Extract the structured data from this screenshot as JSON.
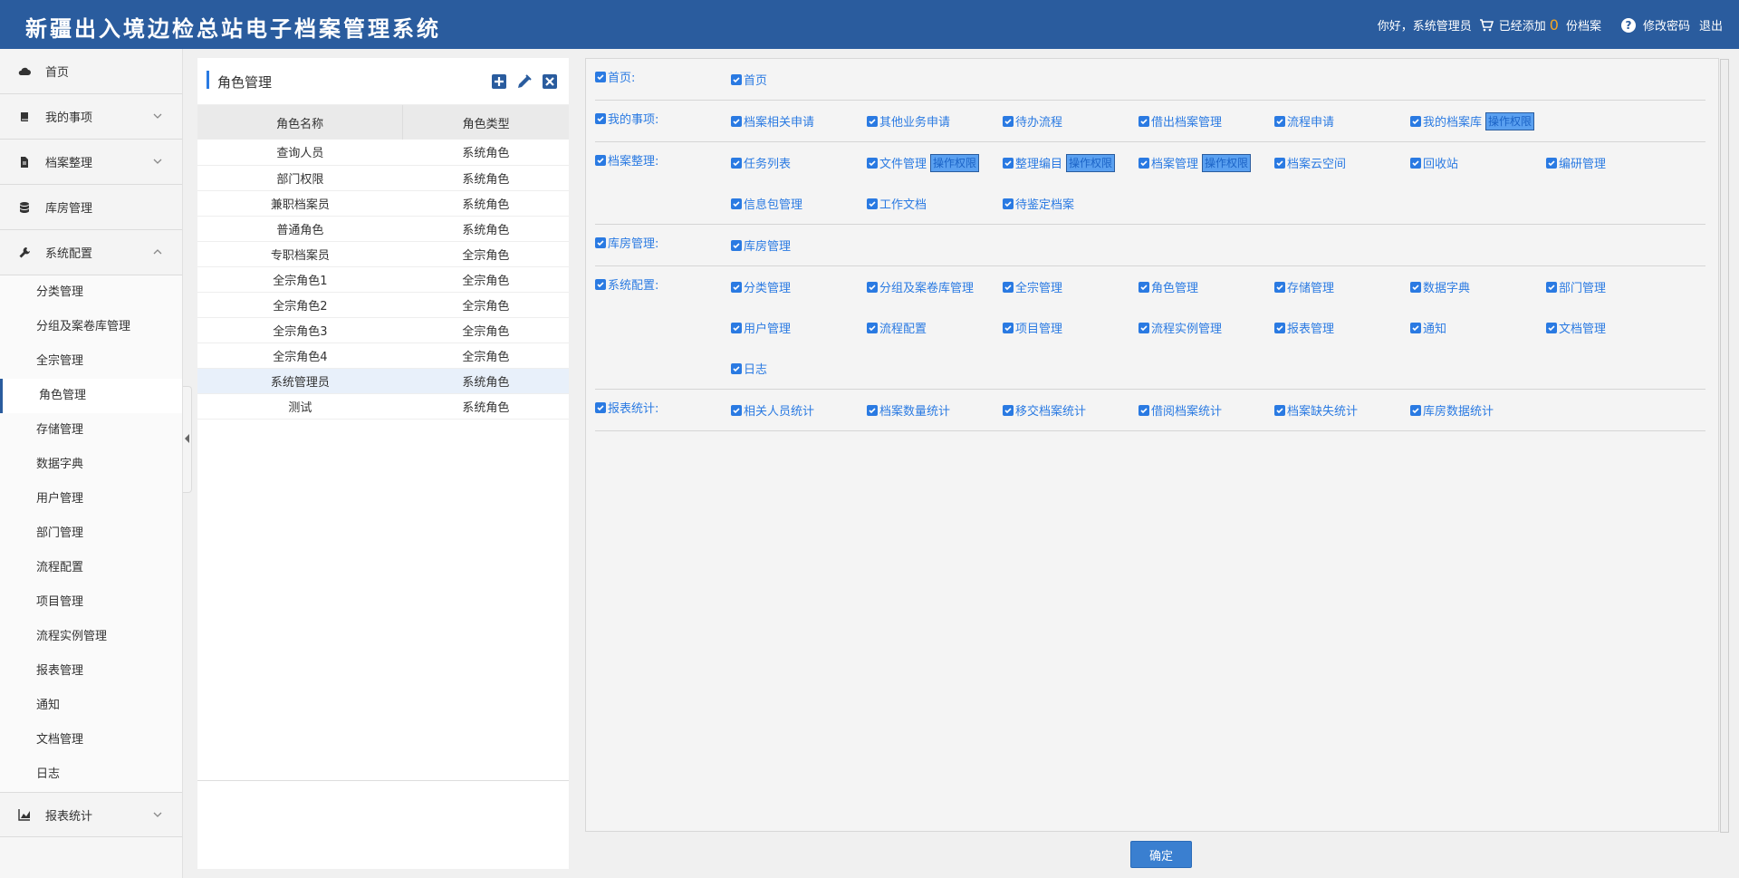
{
  "header": {
    "title": "新疆出入境边检总站电子档案管理系统",
    "greeting": "你好，系统管理员",
    "cart_prefix": "已经添加",
    "cart_count": "0",
    "cart_suffix": "份档案",
    "change_password": "修改密码",
    "logout": "退出"
  },
  "sidebar": {
    "groups": [
      {
        "label": "首页",
        "icon": "cloud-icon"
      },
      {
        "label": "我的事项",
        "icon": "book-icon"
      },
      {
        "label": "档案整理",
        "icon": "file-icon"
      },
      {
        "label": "库房管理",
        "icon": "database-icon"
      },
      {
        "label": "系统配置",
        "icon": "wrench-icon"
      }
    ],
    "sub_items": [
      "分类管理",
      "分组及案卷库管理",
      "全宗管理",
      "角色管理",
      "存储管理",
      "数据字典",
      "用户管理",
      "部门管理",
      "流程配置",
      "项目管理",
      "流程实例管理",
      "报表管理",
      "通知",
      "文档管理",
      "日志"
    ],
    "bottom_group": {
      "label": "报表统计",
      "icon": "chart-icon"
    }
  },
  "role_panel": {
    "title": "角色管理",
    "col_name": "角色名称",
    "col_type": "角色类型",
    "rows": [
      {
        "name": "查询人员",
        "type": "系统角色"
      },
      {
        "name": "部门权限",
        "type": "系统角色"
      },
      {
        "name": "兼职档案员",
        "type": "系统角色"
      },
      {
        "name": "普通角色",
        "type": "系统角色"
      },
      {
        "name": "专职档案员",
        "type": "全宗角色"
      },
      {
        "name": "全宗角色1",
        "type": "全宗角色"
      },
      {
        "name": "全宗角色2",
        "type": "全宗角色"
      },
      {
        "name": "全宗角色3",
        "type": "全宗角色"
      },
      {
        "name": "全宗角色4",
        "type": "全宗角色"
      },
      {
        "name": "系统管理员",
        "type": "系统角色"
      },
      {
        "name": "测试",
        "type": "系统角色"
      }
    ]
  },
  "permissions": {
    "op_label": "操作权限",
    "sections": [
      {
        "category": "首页:",
        "items": [
          {
            "label": "首页"
          }
        ]
      },
      {
        "category": "我的事项:",
        "items": [
          {
            "label": "档案相关申请"
          },
          {
            "label": "其他业务申请"
          },
          {
            "label": "待办流程"
          },
          {
            "label": "借出档案管理"
          },
          {
            "label": "流程申请"
          },
          {
            "label": "我的档案库",
            "op": true
          }
        ]
      },
      {
        "category": "档案整理:",
        "items": [
          {
            "label": "任务列表"
          },
          {
            "label": "文件管理",
            "op": true
          },
          {
            "label": "整理编目",
            "op": true
          },
          {
            "label": "档案管理",
            "op": true
          },
          {
            "label": "档案云空间"
          },
          {
            "label": "回收站"
          },
          {
            "label": "编研管理"
          },
          {
            "label": "信息包管理"
          },
          {
            "label": "工作文档"
          },
          {
            "label": "待鉴定档案"
          }
        ]
      },
      {
        "category": "库房管理:",
        "items": [
          {
            "label": "库房管理"
          }
        ]
      },
      {
        "category": "系统配置:",
        "items": [
          {
            "label": "分类管理"
          },
          {
            "label": "分组及案卷库管理"
          },
          {
            "label": "全宗管理"
          },
          {
            "label": "角色管理"
          },
          {
            "label": "存储管理"
          },
          {
            "label": "数据字典"
          },
          {
            "label": "部门管理"
          },
          {
            "label": "用户管理"
          },
          {
            "label": "流程配置"
          },
          {
            "label": "项目管理"
          },
          {
            "label": "流程实例管理"
          },
          {
            "label": "报表管理"
          },
          {
            "label": "通知"
          },
          {
            "label": "文档管理"
          },
          {
            "label": "日志"
          }
        ]
      },
      {
        "category": "报表统计:",
        "items": [
          {
            "label": "相关人员统计"
          },
          {
            "label": "档案数量统计"
          },
          {
            "label": "移交档案统计"
          },
          {
            "label": "借阅档案统计"
          },
          {
            "label": "档案缺失统计"
          },
          {
            "label": "库房数据统计"
          }
        ]
      }
    ]
  },
  "confirm_label": "确定",
  "colors": {
    "header": "#2a5c9e",
    "accent": "#2a7ae2",
    "cart_count": "#f5a623"
  }
}
